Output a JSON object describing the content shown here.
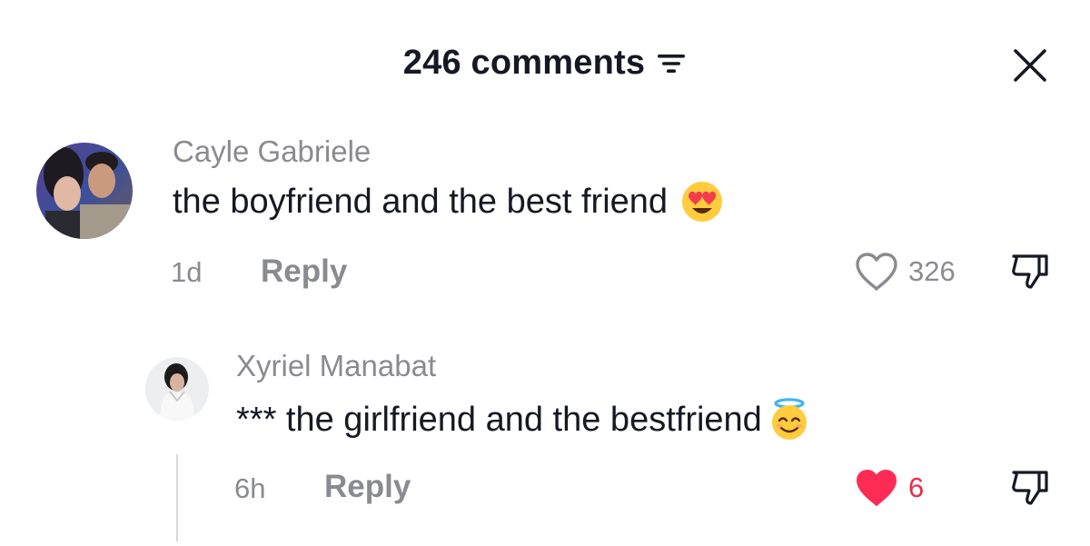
{
  "header": {
    "title": "246 comments",
    "filter_icon": "filter-icon",
    "close_icon": "close-icon"
  },
  "comments": [
    {
      "username": "Cayle Gabriele",
      "text": "the boyfriend and the best friend",
      "emoji": "heart-eyes-emoji",
      "time": "1d",
      "reply_label": "Reply",
      "likes": "326",
      "liked": false
    },
    {
      "username": "Xyriel Manabat",
      "text": "*** the girlfriend and the bestfriend",
      "emoji": "angel-emoji",
      "time": "6h",
      "reply_label": "Reply",
      "likes": "6",
      "liked": true
    }
  ],
  "colors": {
    "text_primary": "#161823",
    "text_secondary": "#8a8b91",
    "liked_red": "#fe2c55",
    "emoji_yellow": "#ffcc3e"
  }
}
